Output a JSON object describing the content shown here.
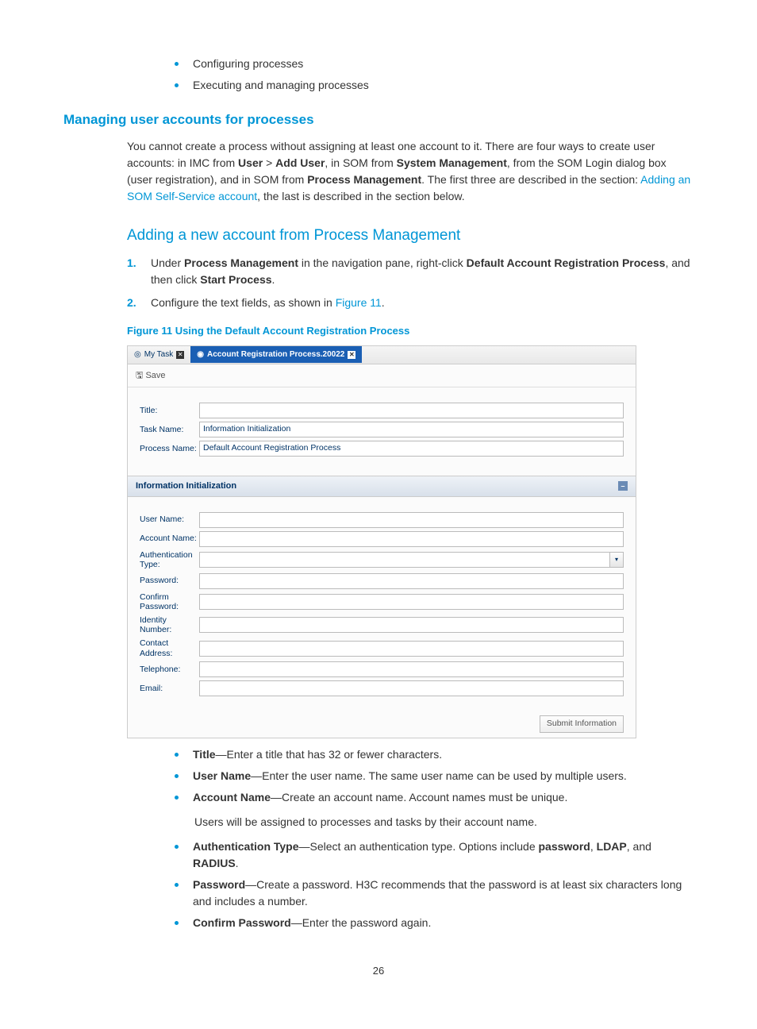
{
  "intro_bullets": [
    "Configuring processes",
    "Executing and managing processes"
  ],
  "section_heading": "Managing user accounts for processes",
  "para1_pre": "You cannot create a process without assigning at least one account to it. There are four ways to create user accounts: in IMC from ",
  "para1_b1": "User",
  "para1_mid1": " > ",
  "para1_b2": "Add User",
  "para1_mid2": ", in SOM from ",
  "para1_b3": "System Management",
  "para1_mid3": ", from the SOM Login dialog box (user registration), and in SOM from ",
  "para1_b4": "Process Management",
  "para1_mid4": ". The first three are described in the section: ",
  "para1_link": "Adding an SOM Self-Service account",
  "para1_end": ", the last is described in the section below.",
  "subsection_heading": "Adding a new account from Process Management",
  "step1_pre": "Under ",
  "step1_b1": "Process Management",
  "step1_mid1": " in the navigation pane, right-click ",
  "step1_b2": "Default Account Registration Process",
  "step1_mid2": ", and then click ",
  "step1_b3": "Start Process",
  "step1_end": ".",
  "step2_pre": "Configure the text fields, as shown in ",
  "step2_link": "Figure 11",
  "step2_end": ".",
  "figure_caption": "Figure 11 Using the Default Account Registration Process",
  "screenshot": {
    "tab1": "My Task",
    "tab2": "Account Registration Process.20022",
    "save": "Save",
    "title_label": "Title:",
    "taskname_label": "Task Name:",
    "taskname_value": "Information Initialization",
    "processname_label": "Process Name:",
    "processname_value": "Default Account Registration Process",
    "section_header": "Information Initialization",
    "username_label": "User Name:",
    "accountname_label": "Account Name:",
    "authtype_label": "Authentication Type:",
    "password_label": "Password:",
    "confirmpw_label": "Confirm Password:",
    "identity_label": "Identity Number:",
    "contact_label": "Contact Address:",
    "telephone_label": "Telephone:",
    "email_label": "Email:",
    "submit": "Submit Information"
  },
  "fields": [
    {
      "name": "Title",
      "desc": "—Enter a title that has 32 or fewer characters."
    },
    {
      "name": "User Name",
      "desc": "—Enter the user name. The same user name can be used by multiple users."
    },
    {
      "name": "Account Name",
      "desc": "—Create an account name. Account names must be unique."
    }
  ],
  "sub_note": "Users will be assigned to processes and tasks by their account name.",
  "field_auth_name": "Authentication Type",
  "field_auth_pre": "—Select an authentication type. Options include ",
  "field_auth_b1": "password",
  "field_auth_mid1": ", ",
  "field_auth_b2": "LDAP",
  "field_auth_mid2": ", and ",
  "field_auth_b3": "RADIUS",
  "field_auth_end": ".",
  "field_pw_name": "Password",
  "field_pw_desc": "—Create a password. H3C recommends that the password is at least six characters long and includes a number.",
  "field_cpw_name": "Confirm Password",
  "field_cpw_desc": "—Enter the password again.",
  "page_number": "26"
}
